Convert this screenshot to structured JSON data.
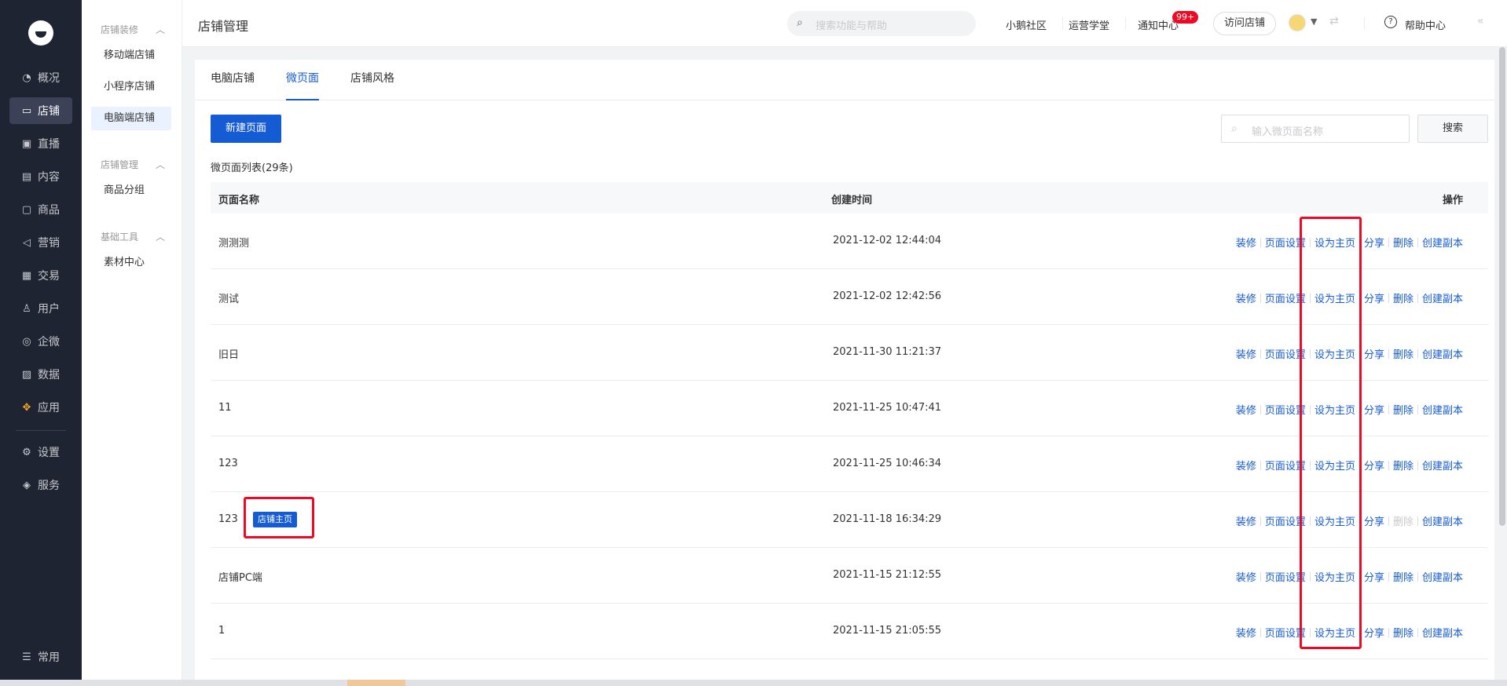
{
  "nav": {
    "items": [
      {
        "label": "概况",
        "icon": "pie-chart-icon"
      },
      {
        "label": "店铺",
        "icon": "store-icon",
        "active": true
      },
      {
        "label": "直播",
        "icon": "live-icon"
      },
      {
        "label": "内容",
        "icon": "document-icon"
      },
      {
        "label": "商品",
        "icon": "goods-icon"
      },
      {
        "label": "营销",
        "icon": "megaphone-icon"
      },
      {
        "label": "交易",
        "icon": "trade-icon"
      },
      {
        "label": "用户",
        "icon": "user-icon"
      },
      {
        "label": "企微",
        "icon": "wecom-icon"
      },
      {
        "label": "数据",
        "icon": "data-icon"
      },
      {
        "label": "应用",
        "icon": "apps-icon"
      },
      {
        "label": "设置",
        "icon": "gear-icon"
      },
      {
        "label": "服务",
        "icon": "service-icon"
      }
    ],
    "common": {
      "label": "常用",
      "icon": "list-icon"
    }
  },
  "subnav": {
    "groups": [
      {
        "title": "店铺装修",
        "items": [
          "移动端店铺",
          "小程序店铺",
          "电脑端店铺"
        ]
      },
      {
        "title": "店铺管理",
        "items": [
          "商品分组"
        ]
      },
      {
        "title": "基础工具",
        "items": [
          "素材中心"
        ]
      }
    ],
    "active": "电脑端店铺"
  },
  "topbar": {
    "title": "店铺管理",
    "search_placeholder": "搜索功能与帮助",
    "links": [
      "小鹅社区",
      "运营学堂",
      "通知中心"
    ],
    "notify_badge": "99+",
    "visit_label": "访问店铺",
    "help_label": "帮助中心"
  },
  "tabs": [
    "电脑店铺",
    "微页面",
    "店铺风格"
  ],
  "active_tab": "微页面",
  "toolbar": {
    "new_label": "新建页面",
    "search_placeholder": "输入微页面名称",
    "search_label": "搜索"
  },
  "list": {
    "count_label": "微页面列表(29条)",
    "columns": [
      "页面名称",
      "创建时间",
      "操作"
    ],
    "actions": [
      "装修",
      "页面设置",
      "设为主页",
      "分享",
      "删除",
      "创建副本"
    ],
    "home_tag": "店铺主页",
    "rows": [
      {
        "name": "测测测",
        "time": "2021-12-02 12:44:04"
      },
      {
        "name": "测试",
        "time": "2021-12-02 12:42:56"
      },
      {
        "name": "旧日",
        "time": "2021-11-30 11:21:37"
      },
      {
        "name": "11",
        "time": "2021-11-25 10:47:41"
      },
      {
        "name": "123",
        "time": "2021-11-25 10:46:34"
      },
      {
        "name": "123",
        "time": "2021-11-18 16:34:29",
        "is_home": true
      },
      {
        "name": "店铺PC端",
        "time": "2021-11-15 21:12:55"
      },
      {
        "name": "1",
        "time": "2021-11-15 21:05:55"
      }
    ]
  },
  "colors": {
    "primary": "#155bd4",
    "highlight": "#ee0a24",
    "nav_bg": "#1f2433"
  }
}
